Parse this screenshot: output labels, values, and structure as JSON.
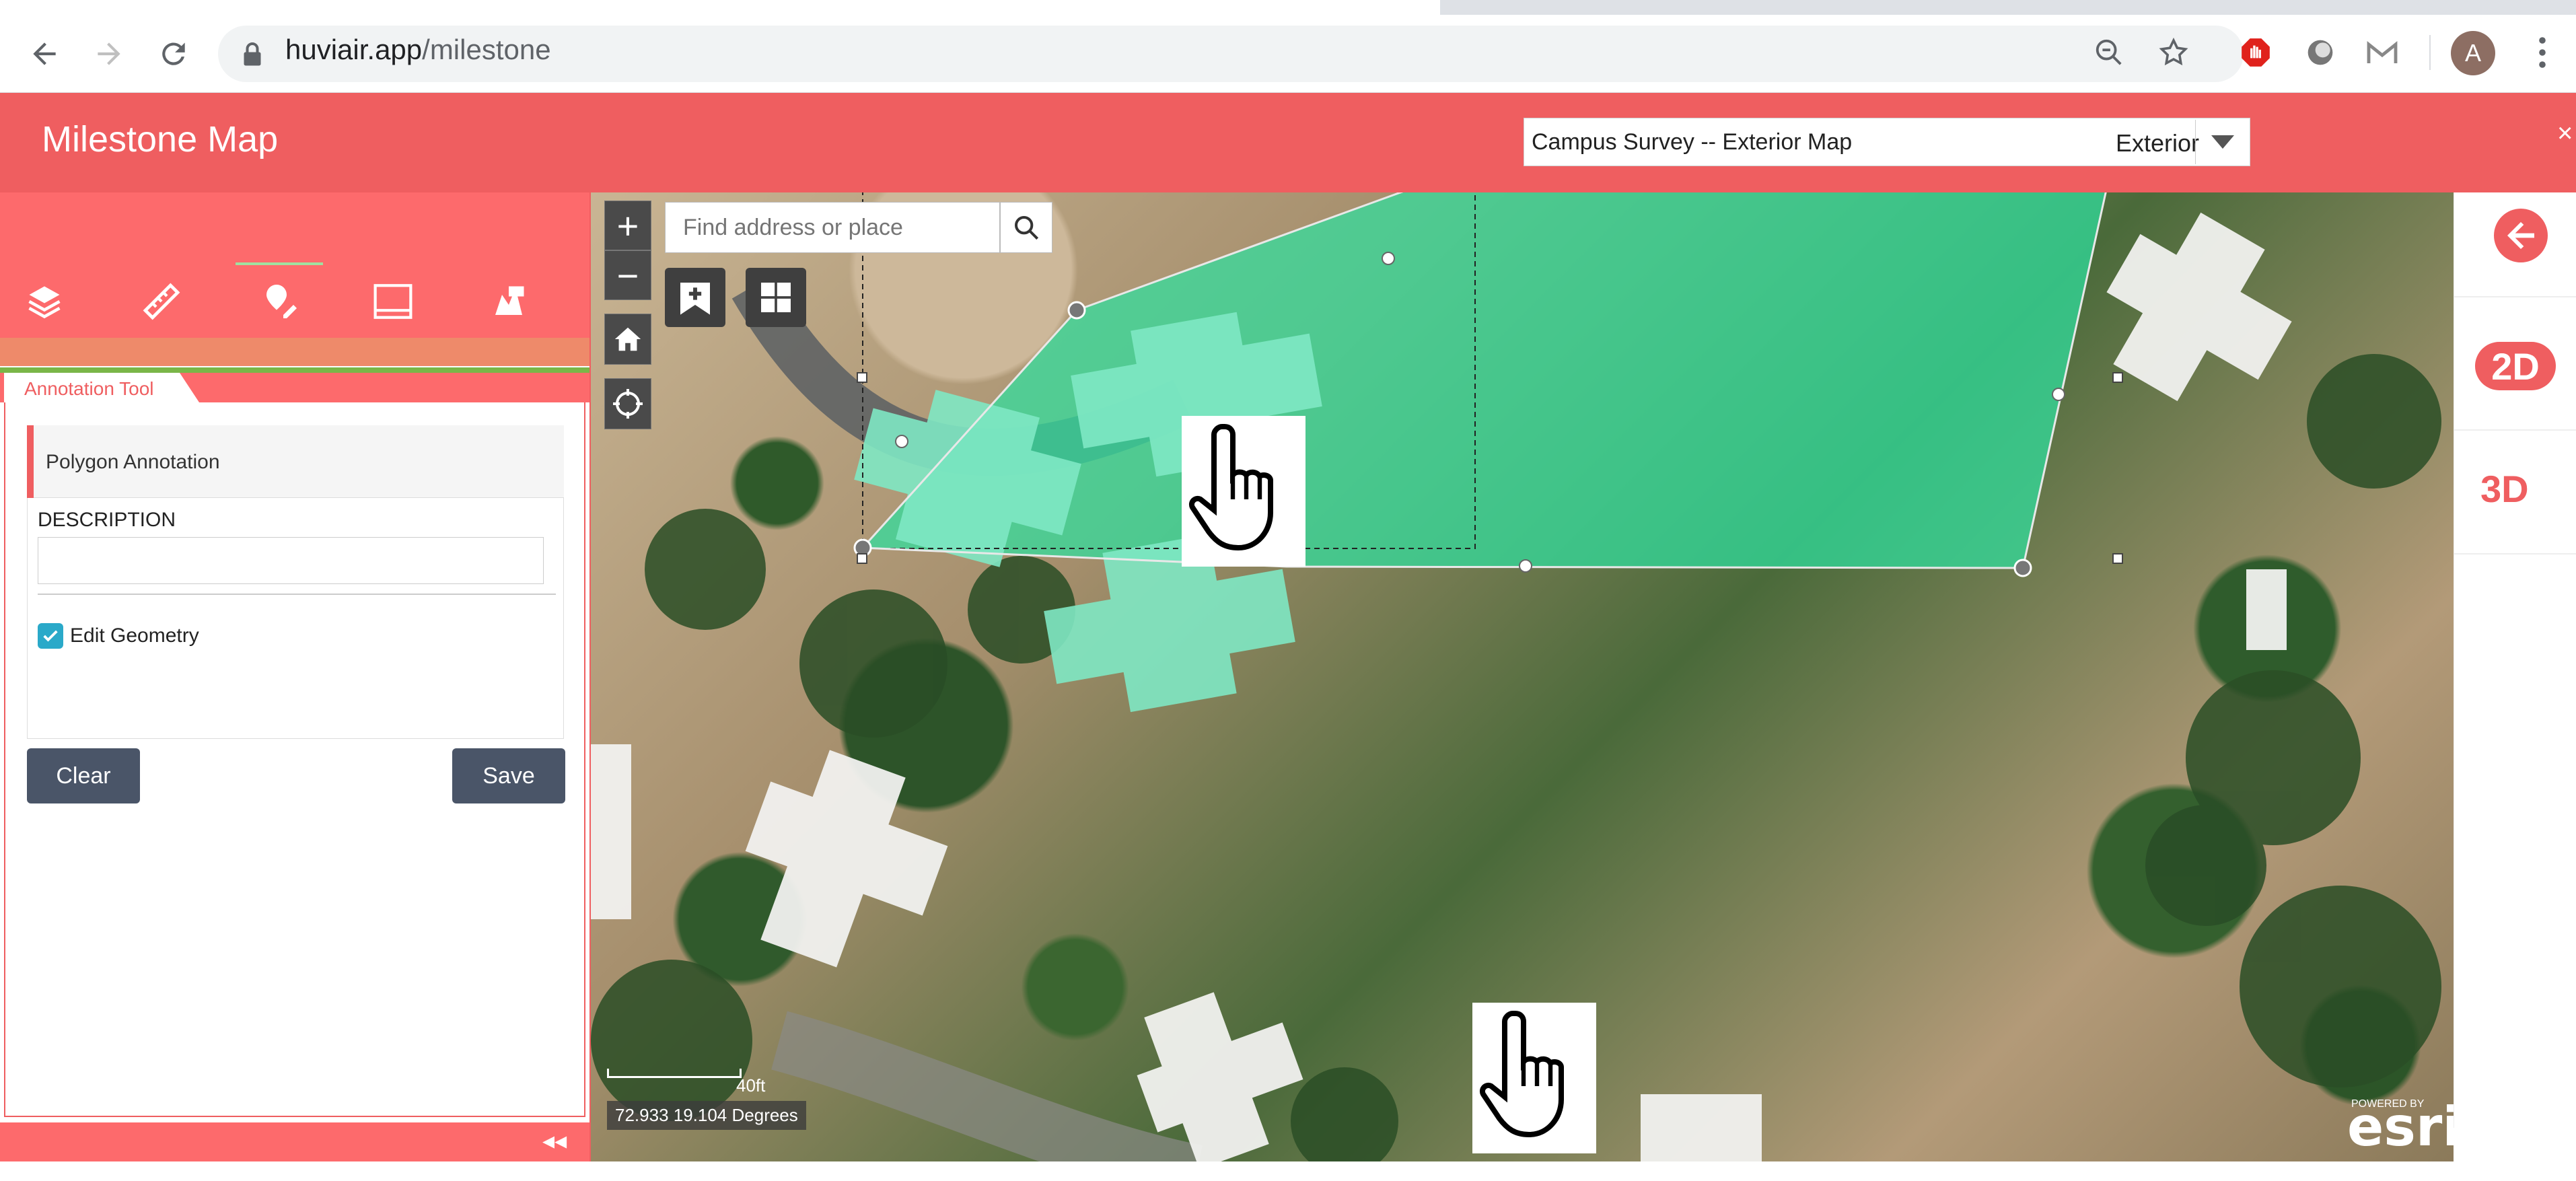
{
  "browser": {
    "url_host": "huviair.app",
    "url_path": "/milestone",
    "avatar_letter": "A"
  },
  "app": {
    "title": "Milestone Map",
    "map_select": {
      "name": "Campus Survey -- Exterior Map",
      "type": "Exterior"
    },
    "close": "×"
  },
  "left_panel": {
    "tools": [
      "layers-icon",
      "ruler-icon",
      "annotation-icon",
      "compare-icon",
      "report-icon"
    ],
    "tab_label": "Annotation Tool",
    "form": {
      "title": "Polygon Annotation",
      "description_label": "DESCRIPTION",
      "description_value": "",
      "edit_geometry_label": "Edit Geometry",
      "edit_geometry_checked": true
    },
    "buttons": {
      "clear": "Clear",
      "save": "Save"
    },
    "collapse": "◂◂"
  },
  "map": {
    "search_placeholder": "Find address or place",
    "zoom_in": "+",
    "zoom_out": "−",
    "scale_label": "40ft",
    "coordinates": "72.933 19.104 Degrees",
    "esri_powered": "POWERED BY",
    "esri_logo": "esri",
    "polygon_color": "#2fe0a0"
  },
  "right_panel": {
    "mode_2d": "2D",
    "mode_3d": "3D",
    "accent": "#ef5e60"
  }
}
